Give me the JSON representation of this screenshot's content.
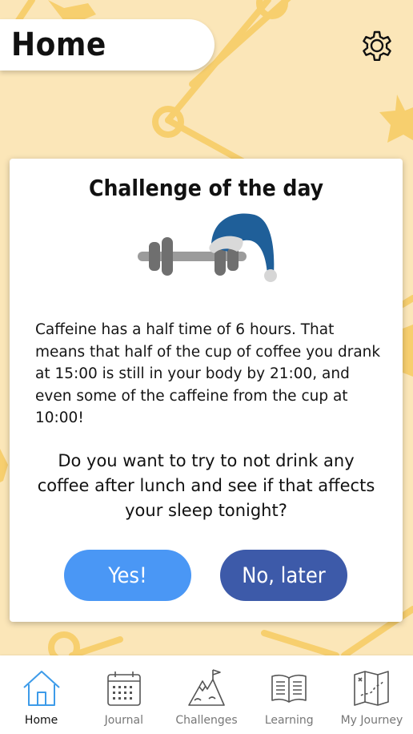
{
  "header": {
    "title": "Home"
  },
  "icons": {
    "settings": "gear-icon"
  },
  "challenge": {
    "title": "Challenge of the day",
    "illustration": "dumbbell-with-nightcap",
    "info": "Caffeine has a half time of 6 hours. That means that half of the cup of coffee you drank at 15:00 is still in your body by 21:00, and even some of the caffeine from the cup at 10:00!",
    "question": "Do you want to try to not drink any coffee after lunch and see if that affects your sleep tonight?",
    "yes_label": "Yes!",
    "later_label": "No, later"
  },
  "nav": {
    "items": [
      {
        "label": "Home",
        "icon": "home-icon",
        "active": true
      },
      {
        "label": "Journal",
        "icon": "calendar-icon",
        "active": false
      },
      {
        "label": "Challenges",
        "icon": "mountain-flag-icon",
        "active": false
      },
      {
        "label": "Learning",
        "icon": "book-icon",
        "active": false
      },
      {
        "label": "My Journey",
        "icon": "map-icon",
        "active": false
      }
    ]
  },
  "colors": {
    "background": "#fbe6b8",
    "decoration": "#f7cf6e",
    "yes_button": "#4a97f5",
    "later_button": "#3d5aa9",
    "active_nav": "#3d9be9"
  }
}
